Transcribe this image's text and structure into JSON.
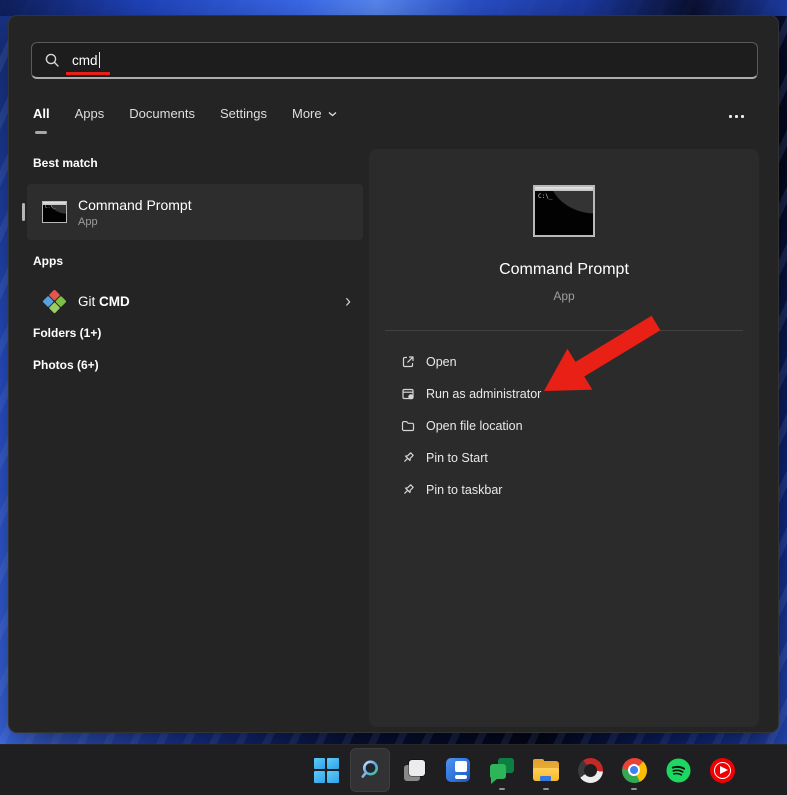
{
  "colors": {
    "panel_bg": "#242424",
    "detail_pane_bg": "#2b2b2b",
    "card_bg": "#2d2d2d",
    "annotation_red": "#e32119",
    "text_primary": "#ffffff",
    "text_secondary": "#9d9d9d",
    "taskbar_bg": "#1f1f21",
    "wallpaper_blue": "#2a55d8"
  },
  "search": {
    "value": "cmd"
  },
  "tabs": {
    "items": [
      {
        "label": "All",
        "active": true
      },
      {
        "label": "Apps",
        "active": false
      },
      {
        "label": "Documents",
        "active": false
      },
      {
        "label": "Settings",
        "active": false
      },
      {
        "label": "More",
        "active": false,
        "has_chevron": true
      }
    ]
  },
  "results": {
    "best_match_label": "Best match",
    "best_match": {
      "title": "Command Prompt",
      "subtitle": "App"
    },
    "apps_label": "Apps",
    "app_item": {
      "name_prefix": "Git ",
      "name_match": "CMD"
    },
    "folders_label": "Folders (1+)",
    "photos_label": "Photos (6+)"
  },
  "detail": {
    "title": "Command Prompt",
    "subtitle": "App",
    "actions": [
      {
        "label": "Open",
        "icon": "open-icon"
      },
      {
        "label": "Run as administrator",
        "icon": "run-as-admin-icon"
      },
      {
        "label": "Open file location",
        "icon": "folder-icon"
      },
      {
        "label": "Pin to Start",
        "icon": "pin-icon"
      },
      {
        "label": "Pin to taskbar",
        "icon": "pin-icon"
      }
    ]
  },
  "annotations": {
    "arrow_points_to": "Run as administrator",
    "underline_under": "cmd",
    "color": "#e32119"
  },
  "icons": {
    "cmd_icon_label": "C:\\_",
    "chevron_right": "›"
  },
  "taskbar": {
    "items": [
      {
        "name": "start",
        "active": false,
        "running": false
      },
      {
        "name": "search",
        "active": true,
        "running": false
      },
      {
        "name": "task-view",
        "active": false,
        "running": false
      },
      {
        "name": "widgets",
        "active": false,
        "running": false
      },
      {
        "name": "chat",
        "active": false,
        "running": true
      },
      {
        "name": "file-explorer",
        "active": false,
        "running": true
      },
      {
        "name": "ring-app",
        "active": false,
        "running": false
      },
      {
        "name": "chrome",
        "active": false,
        "running": true
      },
      {
        "name": "spotify",
        "active": false,
        "running": false
      },
      {
        "name": "youtube-music",
        "active": false,
        "running": false
      }
    ]
  }
}
